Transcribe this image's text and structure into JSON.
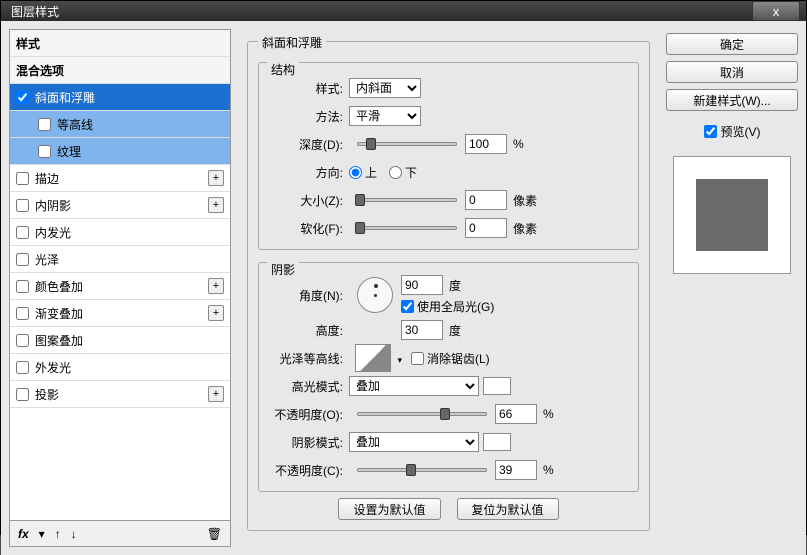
{
  "window": {
    "title": "图层样式"
  },
  "buttons": {
    "ok": "确定",
    "cancel": "取消",
    "new_style": "新建样式(W)...",
    "preview": "预览(V)",
    "make_default": "设置为默认值",
    "reset_default": "复位为默认值",
    "close_x": "x"
  },
  "left": {
    "header_styles": "样式",
    "header_blend": "混合选项",
    "items": [
      {
        "label": "斜面和浮雕",
        "checked": true,
        "selected": true
      },
      {
        "label": "等高线",
        "sub": true,
        "sub_sel": true
      },
      {
        "label": "纹理",
        "sub": true,
        "sub_sel": true
      },
      {
        "label": "描边",
        "add": true
      },
      {
        "label": "内阴影",
        "add": true
      },
      {
        "label": "内发光"
      },
      {
        "label": "光泽"
      },
      {
        "label": "颜色叠加",
        "add": true
      },
      {
        "label": "渐变叠加",
        "add": true
      },
      {
        "label": "图案叠加"
      },
      {
        "label": "外发光"
      },
      {
        "label": "投影",
        "add": true
      }
    ],
    "fx": "fx"
  },
  "center": {
    "panel_title": "斜面和浮雕",
    "struct_title": "结构",
    "style_label": "样式:",
    "style_value": "内斜面",
    "method_label": "方法:",
    "method_value": "平滑",
    "depth_label": "深度(D):",
    "depth_value": "100",
    "depth_unit": "%",
    "direction_label": "方向:",
    "dir_up": "上",
    "dir_down": "下",
    "size_label": "大小(Z):",
    "size_value": "0",
    "size_unit": "像素",
    "soften_label": "软化(F):",
    "soften_value": "0",
    "soften_unit": "像素",
    "shadow_title": "阴影",
    "angle_label": "角度(N):",
    "angle_value": "90",
    "angle_unit": "度",
    "global_light": "使用全局光(G)",
    "altitude_label": "高度:",
    "altitude_value": "30",
    "altitude_unit": "度",
    "gloss_label": "光泽等高线:",
    "anti_alias": "消除锯齿(L)",
    "highlight_mode_label": "高光模式:",
    "highlight_mode_value": "叠加",
    "highlight_opacity_label": "不透明度(O):",
    "highlight_opacity_value": "66",
    "highlight_opacity_unit": "%",
    "shadow_mode_label": "阴影模式:",
    "shadow_mode_value": "叠加",
    "shadow_opacity_label": "不透明度(C):",
    "shadow_opacity_value": "39",
    "shadow_opacity_unit": "%"
  }
}
